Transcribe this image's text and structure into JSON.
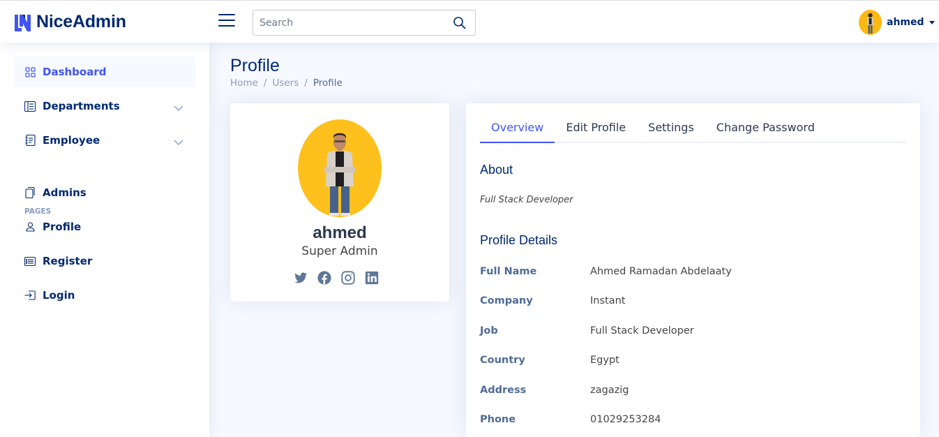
{
  "header": {
    "logo_text": "NiceAdmin",
    "search_placeholder": "Search",
    "user_name": "ahmed",
    "colors": {
      "brand": "#4154f1",
      "navy": "#012970"
    }
  },
  "sidebar": {
    "items": [
      {
        "label": "Dashboard",
        "icon": "grid-icon",
        "active": true
      },
      {
        "label": "Departments",
        "icon": "layout-text-sidebar-icon",
        "expandable": true
      },
      {
        "label": "Employee",
        "icon": "journal-text-icon",
        "expandable": true
      }
    ],
    "pages_heading": "PAGES",
    "pages": [
      {
        "label": "Admins",
        "icon": "files-icon"
      },
      {
        "label": "Profile",
        "icon": "person-icon"
      },
      {
        "label": "Register",
        "icon": "card-list-icon"
      },
      {
        "label": "Login",
        "icon": "box-arrow-in-right-icon"
      }
    ]
  },
  "page": {
    "title": "Profile",
    "breadcrumb": [
      "Home",
      "Users",
      "Profile"
    ]
  },
  "profile_card": {
    "name": "ahmed",
    "role": "Super Admin",
    "socials": [
      "twitter-icon",
      "facebook-icon",
      "instagram-icon",
      "linkedin-icon"
    ],
    "avatar_color": "#fdc01c"
  },
  "details_card": {
    "tabs": [
      "Overview",
      "Edit Profile",
      "Settings",
      "Change Password"
    ],
    "active_tab": "Overview",
    "about_title": "About",
    "about_text": "Full Stack Developer",
    "details_title": "Profile Details",
    "rows": [
      {
        "label": "Full Name",
        "value": "Ahmed Ramadan Abdelaaty"
      },
      {
        "label": "Company",
        "value": "Instant"
      },
      {
        "label": "Job",
        "value": "Full Stack Developer"
      },
      {
        "label": "Country",
        "value": "Egypt"
      },
      {
        "label": "Address",
        "value": "zagazig"
      },
      {
        "label": "Phone",
        "value": "01029253284"
      }
    ]
  }
}
